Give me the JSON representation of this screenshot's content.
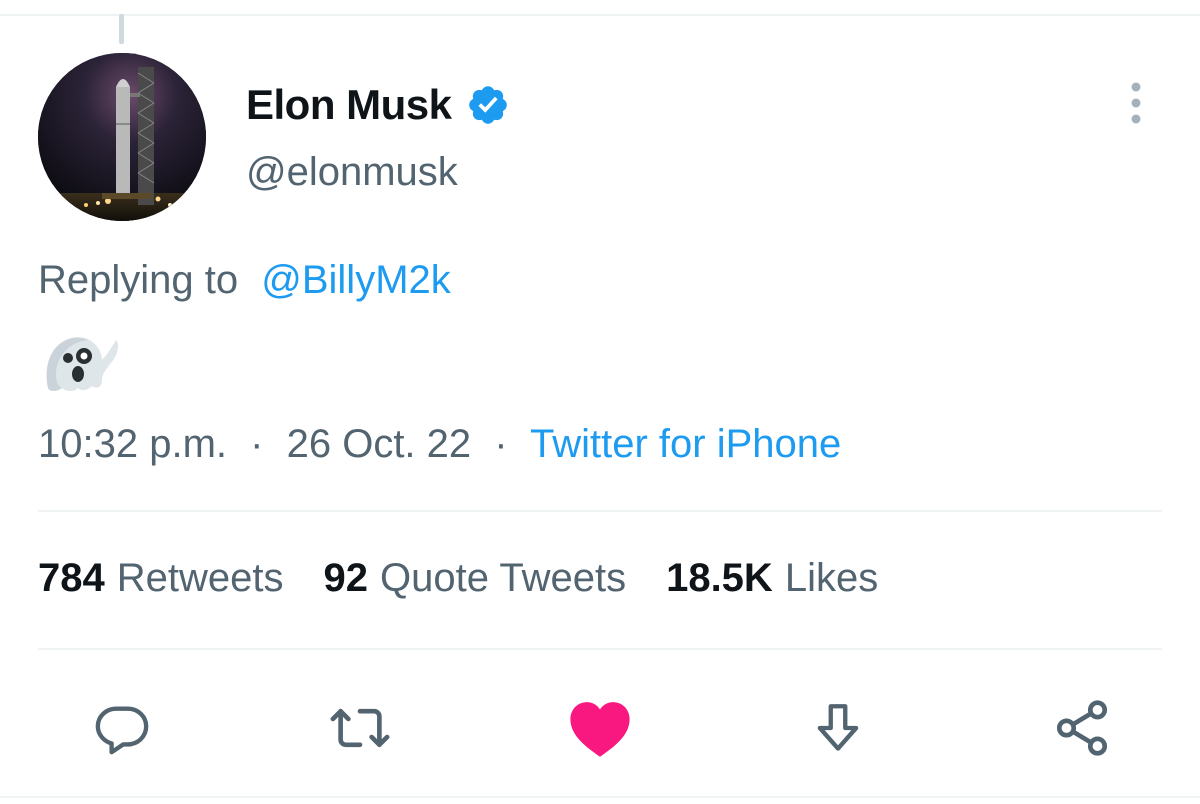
{
  "tweet": {
    "author": {
      "display_name": "Elon Musk",
      "handle": "@elonmusk",
      "verified": true
    },
    "reply": {
      "prefix": "Replying to",
      "mention": "@BillyM2k"
    },
    "content": {
      "emoji": "ghost-emoji"
    },
    "meta": {
      "time": "10:32 p.m.",
      "separator": "·",
      "date": "26 Oct. 22",
      "source": "Twitter for iPhone"
    },
    "stats": {
      "retweets_count": "784",
      "retweets_label": "Retweets",
      "quotes_count": "92",
      "quotes_label": "Quote Tweets",
      "likes_count": "18.5K",
      "likes_label": "Likes"
    },
    "actions": {
      "icons": [
        "reply-icon",
        "retweet-icon",
        "like-icon",
        "save-icon",
        "share-icon"
      ]
    }
  },
  "colors": {
    "accent": "#1d9bf0",
    "like": "#f91880",
    "secondary_text": "#536471",
    "primary_text": "#0f1419",
    "divider": "#eff3f4"
  }
}
